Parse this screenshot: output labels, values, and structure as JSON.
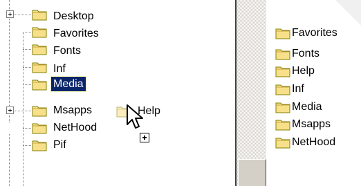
{
  "tree": {
    "items": [
      {
        "label": "Desktop",
        "expandable": true,
        "selected": false
      },
      {
        "label": "Favorites",
        "expandable": false,
        "selected": false
      },
      {
        "label": "Fonts",
        "expandable": false,
        "selected": false
      },
      {
        "label": "Inf",
        "expandable": false,
        "selected": false
      },
      {
        "label": "Media",
        "expandable": false,
        "selected": true
      },
      {
        "label": "Msapps",
        "expandable": true,
        "selected": false
      },
      {
        "label": "NetHood",
        "expandable": false,
        "selected": false
      },
      {
        "label": "Pif",
        "expandable": false,
        "selected": false
      }
    ]
  },
  "drag": {
    "label": "Help",
    "operation": "copy",
    "cursor_icon": "arrow-cursor-icon"
  },
  "list": {
    "items": [
      {
        "label": "Favorites"
      },
      {
        "label": "Fonts"
      },
      {
        "label": "Help"
      },
      {
        "label": "Inf"
      },
      {
        "label": "Media"
      },
      {
        "label": "Msapps"
      },
      {
        "label": "NetHood"
      }
    ]
  },
  "colors": {
    "folder_fill": "#f8e08a",
    "folder_shade": "#c8a040",
    "selection": "#0a246a",
    "scroll_face": "#d4d0c8"
  },
  "icons": {
    "folder": "folder-icon",
    "expand": "expand-plus-icon"
  }
}
